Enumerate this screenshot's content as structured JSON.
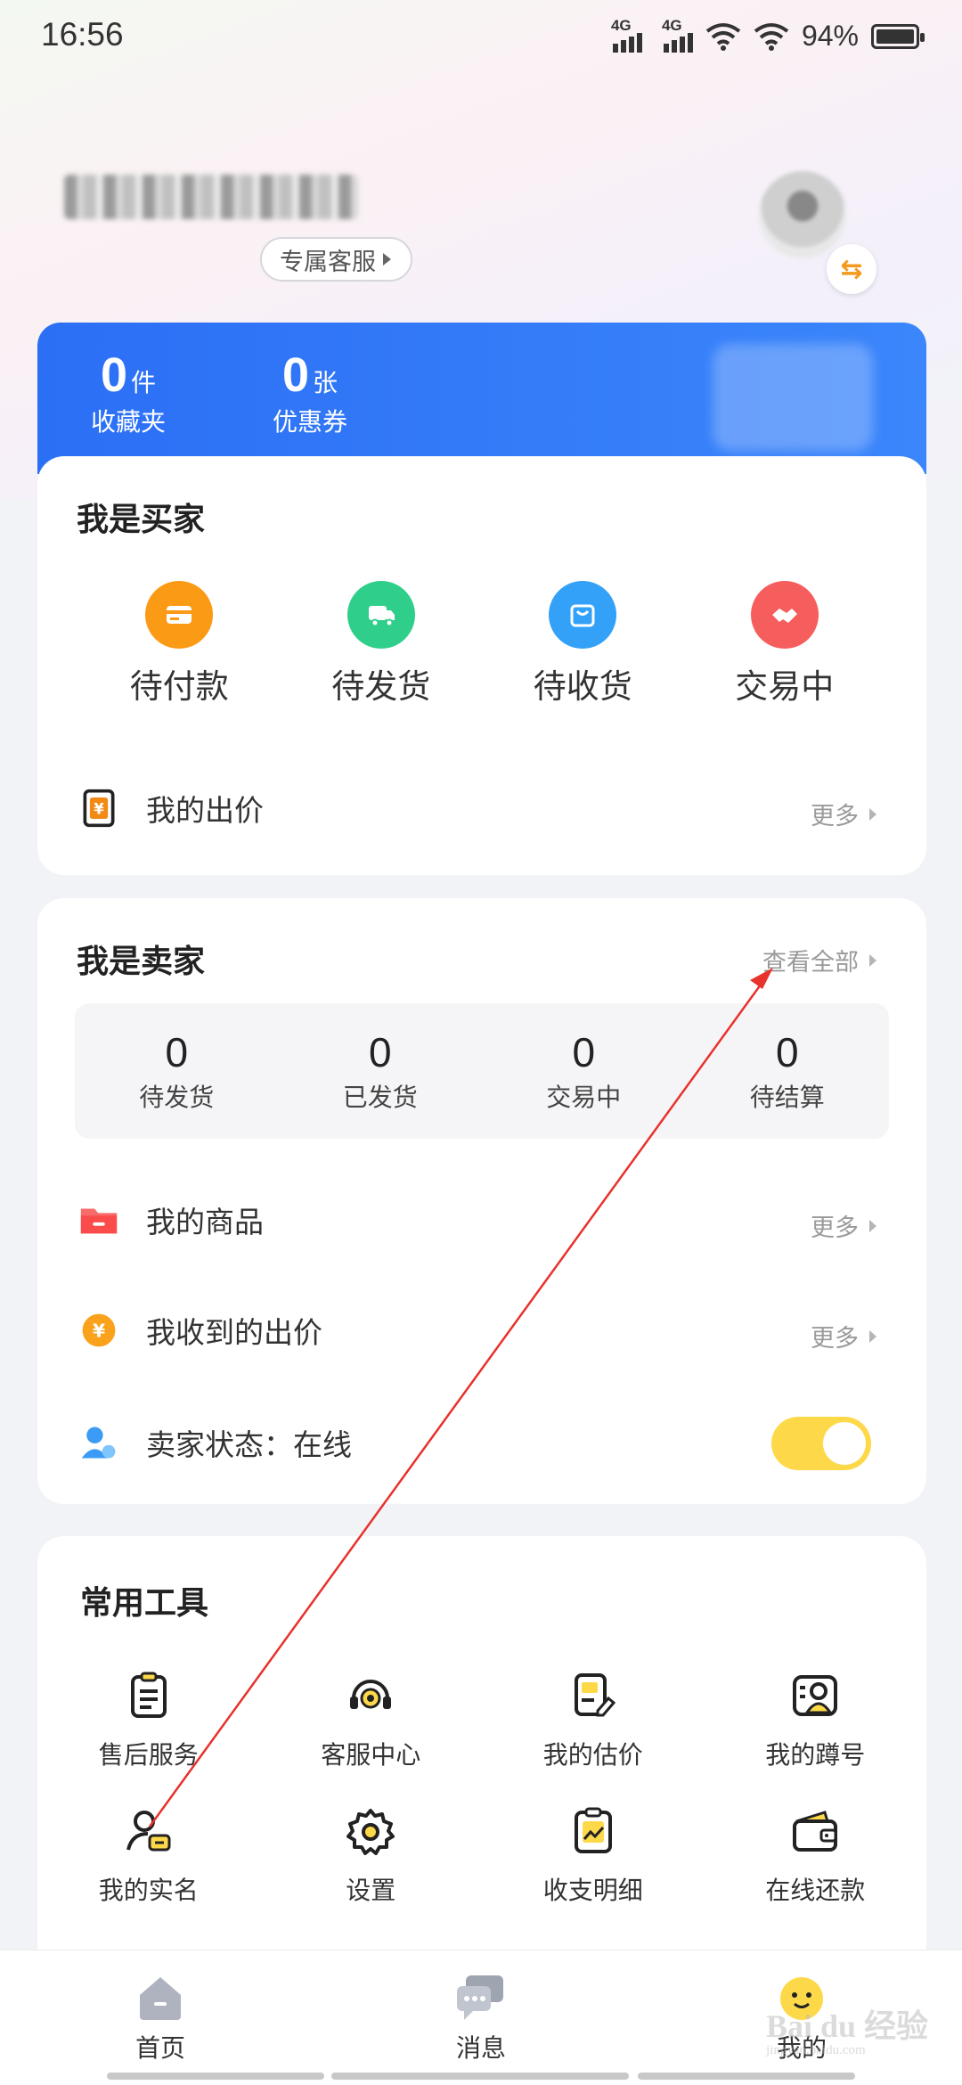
{
  "status_bar": {
    "time": "16:56",
    "network_1": "4G",
    "network_2": "4G",
    "battery": "94%"
  },
  "profile": {
    "user_name": "████████",
    "service_chip": "专属客服"
  },
  "stats": [
    {
      "num": "0",
      "unit": "件",
      "label": "收藏夹"
    },
    {
      "num": "0",
      "unit": "张",
      "label": "优惠券"
    }
  ],
  "buyer": {
    "title": "我是买家",
    "items": [
      {
        "label": "待付款",
        "color": "#fb9a14"
      },
      {
        "label": "待发货",
        "color": "#2fcf8b"
      },
      {
        "label": "待收货",
        "color": "#33a1f7"
      },
      {
        "label": "交易中",
        "color": "#f65d5d"
      }
    ],
    "my_bids": "我的出价",
    "more": "更多"
  },
  "seller": {
    "title": "我是卖家",
    "view_all": "查看全部",
    "stats": [
      {
        "num": "0",
        "label": "待发货"
      },
      {
        "num": "0",
        "label": "已发货"
      },
      {
        "num": "0",
        "label": "交易中"
      },
      {
        "num": "0",
        "label": "待结算"
      }
    ],
    "my_goods": "我的商品",
    "received_bids": "我收到的出价",
    "more": "更多",
    "status": "卖家状态：在线",
    "status_on": true
  },
  "tools": {
    "title": "常用工具",
    "items": [
      {
        "label": "售后服务",
        "icon": "clipboard-icon"
      },
      {
        "label": "客服中心",
        "icon": "headset-icon"
      },
      {
        "label": "我的估价",
        "icon": "appraisal-icon"
      },
      {
        "label": "我的蹲号",
        "icon": "watch-account-icon"
      },
      {
        "label": "我的实名",
        "icon": "real-name-icon"
      },
      {
        "label": "设置",
        "icon": "gear-icon"
      },
      {
        "label": "收支明细",
        "icon": "ledger-icon"
      },
      {
        "label": "在线还款",
        "icon": "wallet-icon"
      }
    ]
  },
  "tabbar": {
    "home": "首页",
    "messages": "消息",
    "mine": "我的"
  },
  "watermark": {
    "main": "Bai du 经验",
    "sub": "jingyan.baidu.com"
  },
  "colors": {
    "accent_blue": "#2b6ff5",
    "toggle_yellow": "#fdd94a",
    "annotation_red": "#e8322c"
  }
}
